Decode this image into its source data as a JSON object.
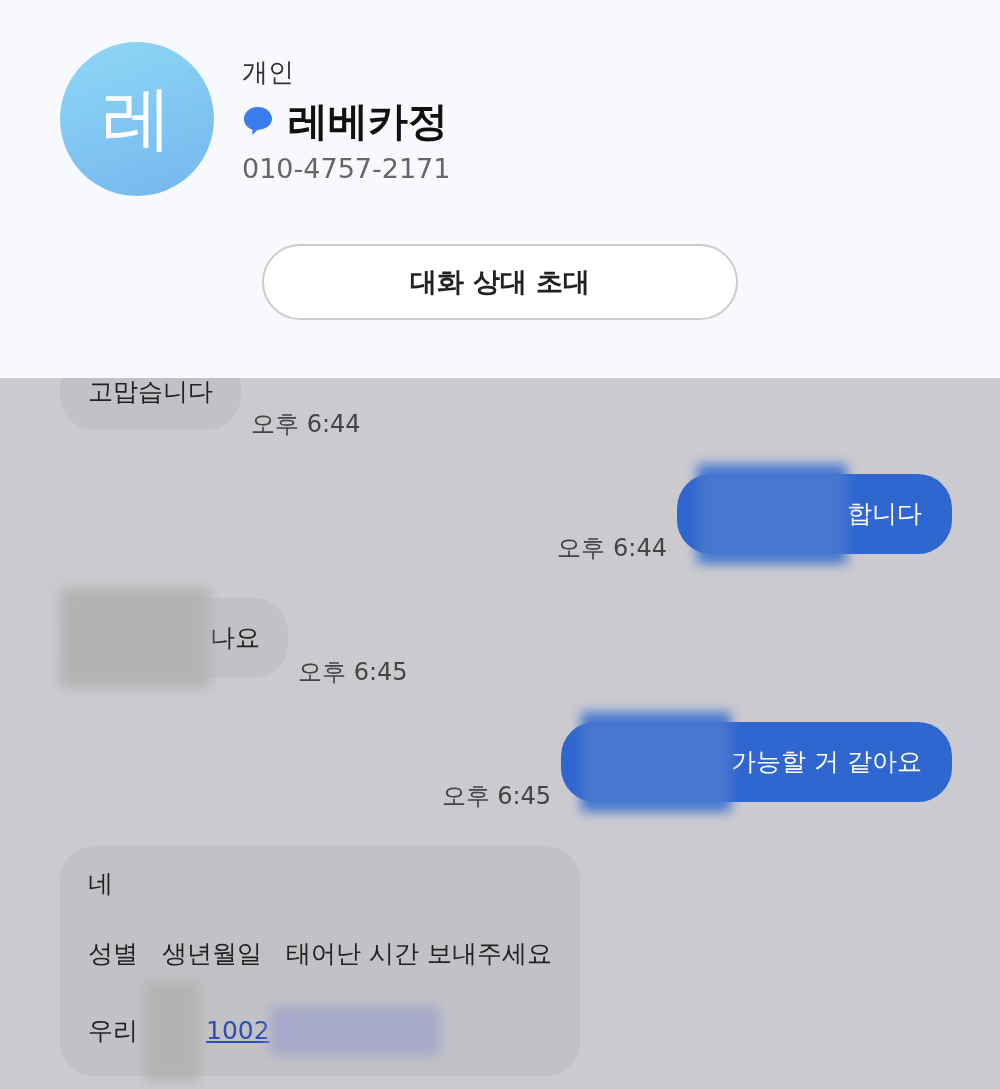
{
  "contact": {
    "avatar_letter": "레",
    "category": "개인",
    "name": "레베카정",
    "phone": "010-4757-2171"
  },
  "invite_button": "대화 상대 초대",
  "messages": [
    {
      "kind": "received",
      "time": "오후 6:44",
      "paragraphs": [
        [
          {
            "kind": "text",
            "text": "고맙습니다"
          }
        ]
      ]
    },
    {
      "kind": "sent",
      "time": "오후 6:44",
      "paragraphs": [
        [
          {
            "kind": "redacted"
          },
          {
            "kind": "text",
            "text": "합니다"
          }
        ]
      ]
    },
    {
      "kind": "received",
      "time": "오후 6:45",
      "paragraphs": [
        [
          {
            "kind": "redacted"
          },
          {
            "kind": "text",
            "text": "나요"
          }
        ]
      ]
    },
    {
      "kind": "sent",
      "time": "오후 6:45",
      "paragraphs": [
        [
          {
            "kind": "redacted"
          },
          {
            "kind": "text",
            "text": "가능할 거 같아요"
          }
        ]
      ]
    },
    {
      "kind": "received",
      "paragraphs": [
        [
          {
            "kind": "text",
            "text": "네"
          }
        ],
        [
          {
            "kind": "text",
            "text": "성별   생년월일   태어난 시간 보내주세요"
          }
        ],
        [
          {
            "kind": "text",
            "text": "우리"
          },
          {
            "kind": "redacted"
          },
          {
            "kind": "link",
            "text": "1002"
          },
          {
            "kind": "redacted-link"
          }
        ]
      ]
    }
  ]
}
